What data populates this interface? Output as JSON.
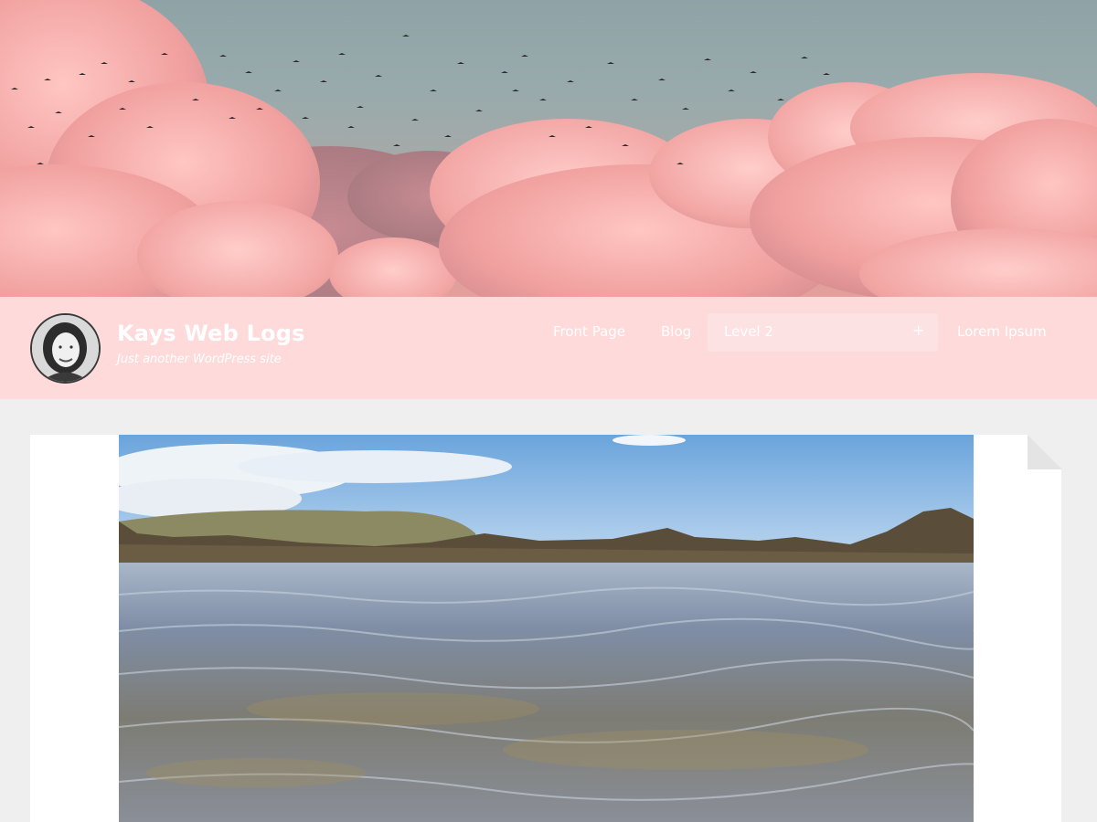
{
  "site": {
    "title": "Kays Web Logs",
    "tagline": "Just another WordPress site"
  },
  "header_image": {
    "subject": "pink-clouds-with-birds"
  },
  "nav": {
    "items": [
      {
        "label": "Front Page"
      },
      {
        "label": "Blog"
      },
      {
        "label": "Level 2"
      },
      {
        "label": "Lorem Ipsum"
      }
    ],
    "expand_symbol": "+"
  },
  "post": {
    "featured_image": {
      "subject": "seashore-rock-pool"
    }
  },
  "colors": {
    "topbar": "#fedadb",
    "nav_highlight": "#fde2e3",
    "page_background": "#efefef",
    "card": "#ffffff",
    "clouds": "#f2a5a3"
  },
  "icons": {
    "expand": "plus-icon",
    "avatar": "user-avatar"
  }
}
